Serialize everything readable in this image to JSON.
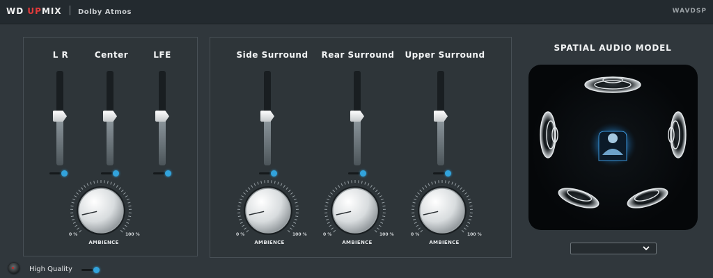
{
  "header": {
    "brand_a": "WD",
    "brand_b": "UP",
    "brand_c": "MIX",
    "product": "Dolby Atmos",
    "vendor": "WAVDSP"
  },
  "channels_front": [
    {
      "label": "L R",
      "level": 0.52,
      "toggle_on": true
    },
    {
      "label": "Center",
      "level": 0.52,
      "toggle_on": true
    },
    {
      "label": "LFE",
      "level": 0.52,
      "toggle_on": true
    }
  ],
  "channels_surround": [
    {
      "label": "Side Surround",
      "level": 0.52,
      "toggle_on": true,
      "ambience": 0.12
    },
    {
      "label": "Rear Surround",
      "level": 0.52,
      "toggle_on": true,
      "ambience": 0.12
    },
    {
      "label": "Upper Surround",
      "level": 0.52,
      "toggle_on": true,
      "ambience": 0.12
    }
  ],
  "front_knob": {
    "label": "AMBIENCE",
    "min_label": "0 %",
    "max_label": "100 %",
    "value": 0.12
  },
  "knob_labels": {
    "label": "AMBIENCE",
    "min_label": "0 %",
    "max_label": "100 %"
  },
  "spatial": {
    "title": "SPATIAL AUDIO MODEL",
    "dropdown_value": ""
  },
  "footer": {
    "high_quality_label": "High Quality",
    "high_quality_on": true
  },
  "colors": {
    "accent": "#32a3dc",
    "brand_red": "#e23b3b",
    "background": "#30373c"
  }
}
